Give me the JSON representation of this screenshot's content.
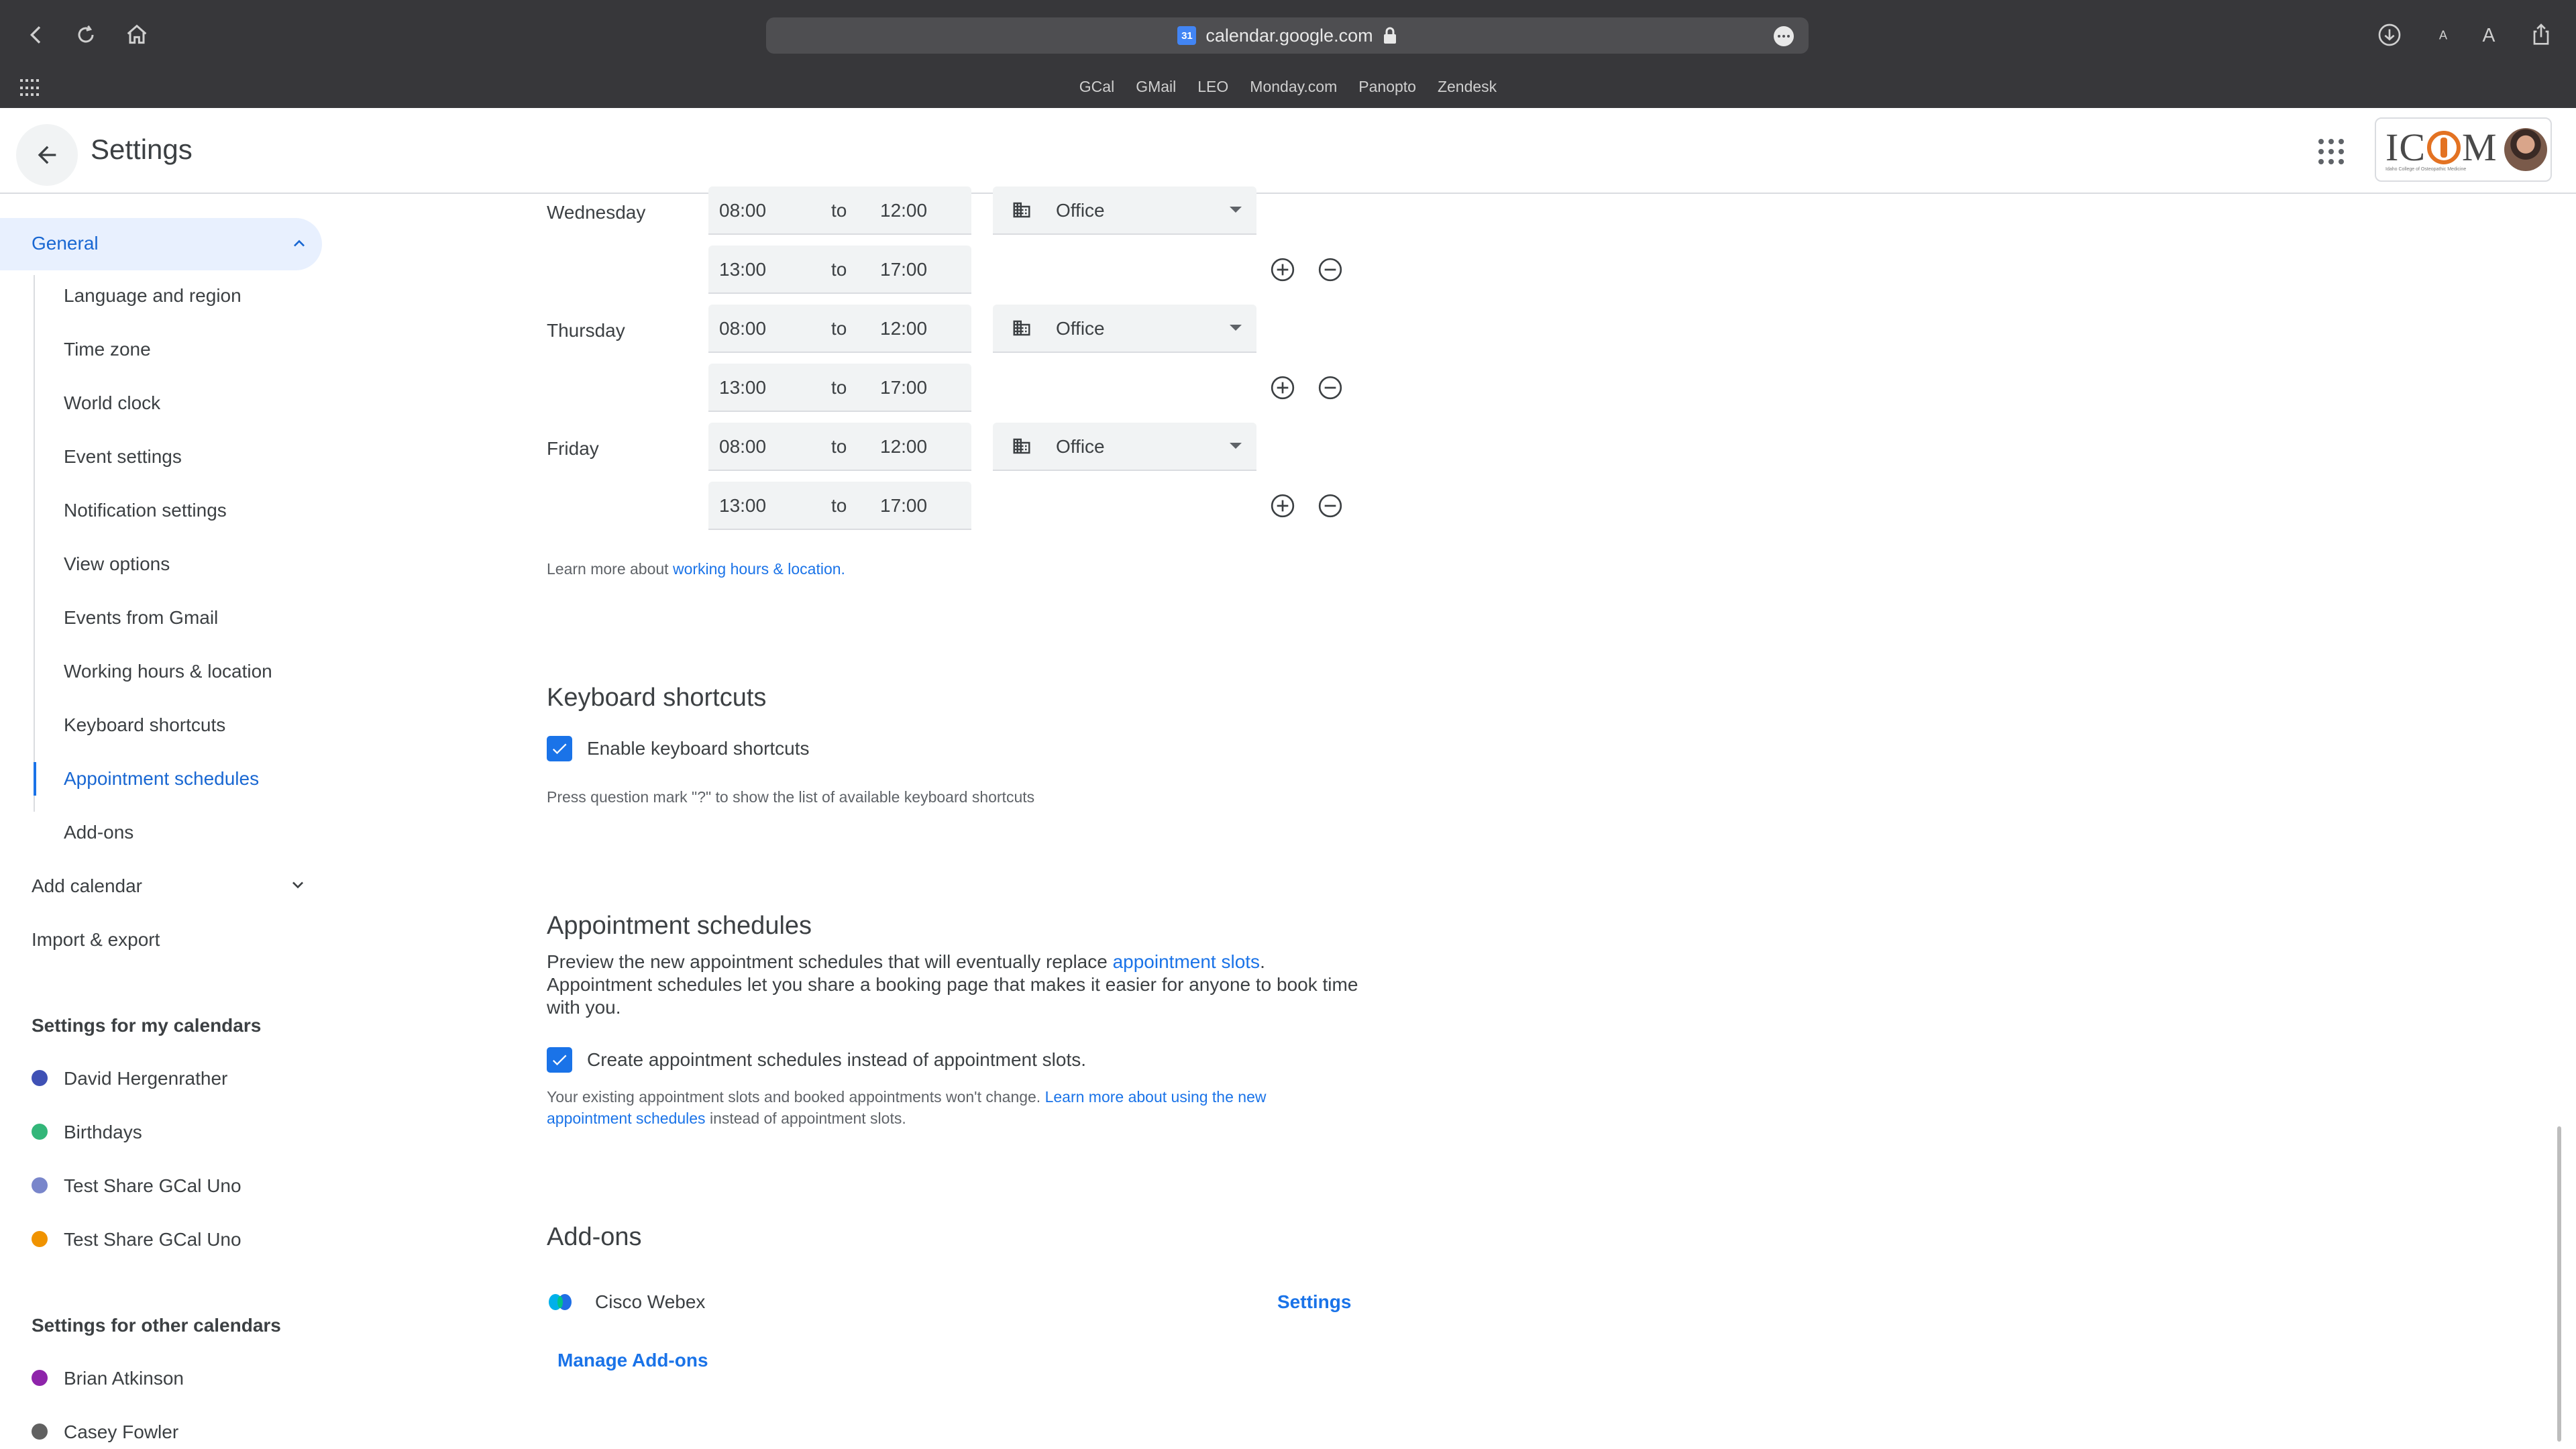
{
  "browser": {
    "url": "calendar.google.com",
    "favicon_text": "31",
    "bookmarks": [
      "GCal",
      "GMail",
      "LEO",
      "Monday.com",
      "Panopto",
      "Zendesk"
    ]
  },
  "header": {
    "title": "Settings",
    "logo_text_pre": "IC",
    "logo_text_post": "M",
    "logo_subtitle": "Idaho College of Osteopathic Medicine"
  },
  "sidebar": {
    "general_label": "General",
    "general_items": [
      "Language and region",
      "Time zone",
      "World clock",
      "Event settings",
      "Notification settings",
      "View options",
      "Events from Gmail",
      "Working hours & location",
      "Keyboard shortcuts",
      "Appointment schedules",
      "Add-ons"
    ],
    "add_calendar": "Add calendar",
    "import_export": "Import & export",
    "my_calendars_heading": "Settings for my calendars",
    "my_calendars": [
      {
        "name": "David Hergenrather",
        "color": "#3f51b5"
      },
      {
        "name": "Birthdays",
        "color": "#33b679"
      },
      {
        "name": "Test Share GCal Uno",
        "color": "#7986cb"
      },
      {
        "name": "Test Share GCal Uno",
        "color": "#f09300"
      }
    ],
    "other_calendars_heading": "Settings for other calendars",
    "other_calendars": [
      {
        "name": "Brian Atkinson",
        "color": "#8e24aa"
      },
      {
        "name": "Casey Fowler",
        "color": "#616161"
      }
    ]
  },
  "working_hours": {
    "days": [
      {
        "day": "Wednesday",
        "slots": [
          {
            "start": "08:00",
            "end": "12:00"
          },
          {
            "start": "13:00",
            "end": "17:00"
          }
        ],
        "location": "Office"
      },
      {
        "day": "Thursday",
        "slots": [
          {
            "start": "08:00",
            "end": "12:00"
          },
          {
            "start": "13:00",
            "end": "17:00"
          }
        ],
        "location": "Office"
      },
      {
        "day": "Friday",
        "slots": [
          {
            "start": "08:00",
            "end": "12:00"
          },
          {
            "start": "13:00",
            "end": "17:00"
          }
        ],
        "location": "Office"
      }
    ],
    "to_label": "to",
    "learn_more_prefix": "Learn more about ",
    "learn_more_link": "working hours & location."
  },
  "keyboard": {
    "title": "Keyboard shortcuts",
    "checkbox_label": "Enable keyboard shortcuts",
    "hint": "Press question mark \"?\" to show the list of available keyboard shortcuts"
  },
  "appointments": {
    "title": "Appointment schedules",
    "desc_prefix": "Preview the new appointment schedules that will eventually replace ",
    "desc_link": "appointment slots",
    "desc_suffix": ". Appointment schedules let you share a booking page that makes it easier for anyone to book time with you.",
    "checkbox_label": "Create appointment schedules instead of appointment slots.",
    "note_prefix": "Your existing appointment slots and booked appointments won't change. ",
    "note_link": "Learn more about using the new appointment schedules",
    "note_suffix": " instead of appointment slots."
  },
  "addons": {
    "title": "Add-ons",
    "items": [
      {
        "name": "Cisco Webex",
        "action": "Settings"
      }
    ],
    "manage_label": "Manage Add-ons"
  },
  "colors": {
    "accent": "#1a73e8",
    "active_nav_bg": "#e8f0fe",
    "chrome_bg": "#37373a"
  }
}
